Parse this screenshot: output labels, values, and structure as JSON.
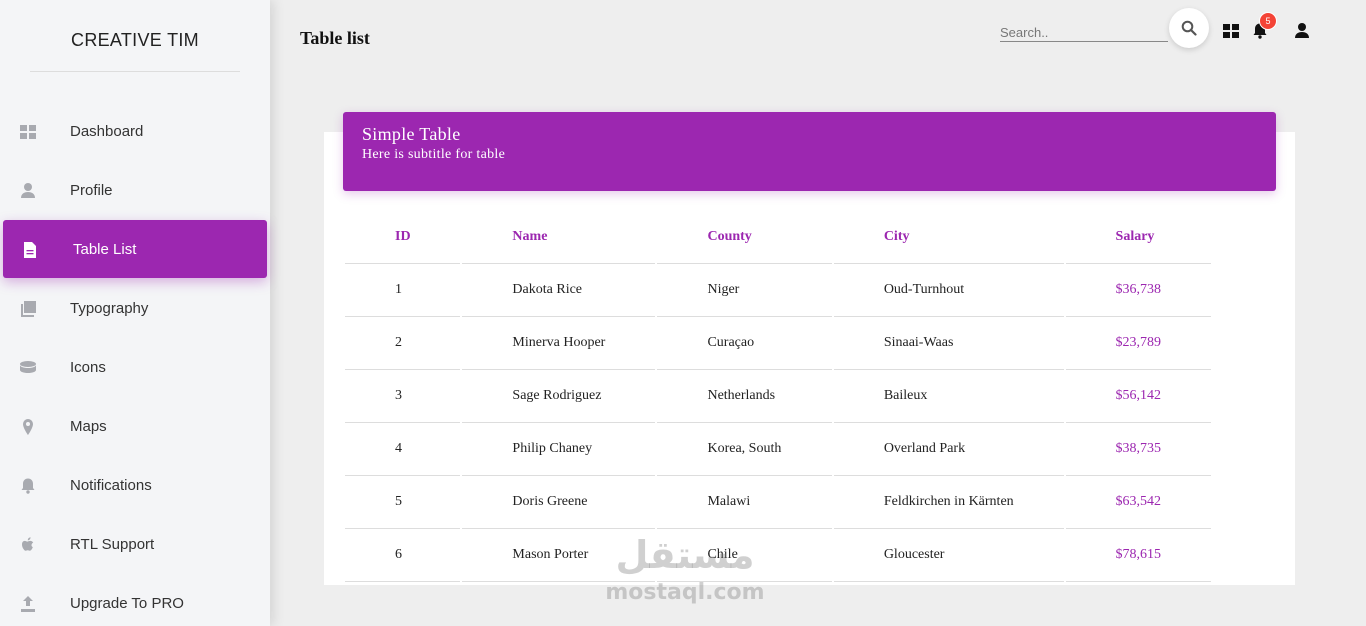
{
  "sidebar": {
    "brand": "CREATIVE TIM",
    "items": [
      {
        "label": "Dashboard",
        "icon": "dashboard-icon"
      },
      {
        "label": "Profile",
        "icon": "person-icon"
      },
      {
        "label": "Table List",
        "icon": "document-icon",
        "active": true
      },
      {
        "label": "Typography",
        "icon": "library-books-icon"
      },
      {
        "label": "Icons",
        "icon": "bubble-chart-icon"
      },
      {
        "label": "Maps",
        "icon": "location-pin-icon"
      },
      {
        "label": "Notifications",
        "icon": "bell-icon"
      },
      {
        "label": "RTL Support",
        "icon": "apple-icon"
      },
      {
        "label": "Upgrade To PRO",
        "icon": "upload-icon"
      }
    ]
  },
  "header": {
    "title": "Table list",
    "search_placeholder": "Search..",
    "notification_count": "5"
  },
  "card": {
    "title": "Simple Table",
    "subtitle": "Here is subtitle for table",
    "columns": [
      "ID",
      "Name",
      "County",
      "City",
      "Salary"
    ],
    "rows": [
      [
        "1",
        "Dakota Rice",
        "Niger",
        "Oud-Turnhout",
        "$36,738"
      ],
      [
        "2",
        "Minerva Hooper",
        "Curaçao",
        "Sinaai-Waas",
        "$23,789"
      ],
      [
        "3",
        "Sage Rodriguez",
        "Netherlands",
        "Baileux",
        "$56,142"
      ],
      [
        "4",
        "Philip Chaney",
        "Korea, South",
        "Overland Park",
        "$38,735"
      ],
      [
        "5",
        "Doris Greene",
        "Malawi",
        "Feldkirchen in Kärnten",
        "$63,542"
      ],
      [
        "6",
        "Mason Porter",
        "Chile",
        "Gloucester",
        "$78,615"
      ]
    ]
  },
  "watermark": {
    "arabic": "مستقل",
    "latin": "mostaql.com"
  },
  "colors": {
    "accent": "#9c27b0",
    "badge": "#f44336"
  }
}
